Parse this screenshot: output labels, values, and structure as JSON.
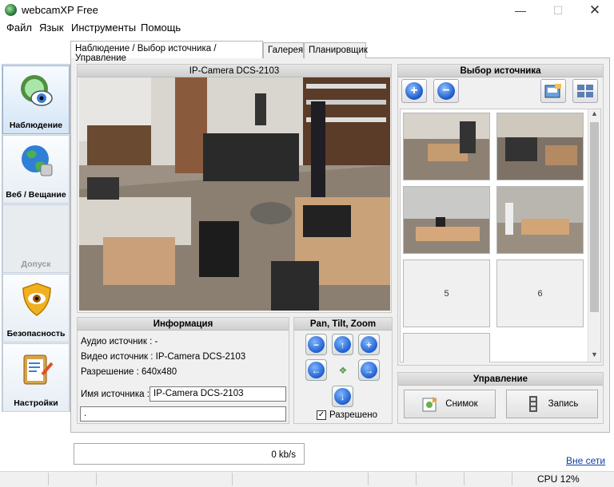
{
  "window": {
    "title": "webcamXP Free"
  },
  "menu": [
    "Файл",
    "Язык",
    "Инструменты",
    "Помощь"
  ],
  "sidebar": {
    "items": [
      {
        "label": "Наблюдение",
        "icon": "eye-camera-icon"
      },
      {
        "label": "Веб / Вещание",
        "icon": "globe-icon"
      },
      {
        "label": "Допуск",
        "icon": ""
      },
      {
        "label": "Безопасность",
        "icon": "shield-eye-icon"
      },
      {
        "label": "Настройки",
        "icon": "clipboard-settings-icon"
      }
    ]
  },
  "tabs": [
    "Наблюдение / Выбор источника / Управление",
    "Галерея",
    "Планировщик"
  ],
  "camera": {
    "title": "IP-Camera DCS-2103"
  },
  "info": {
    "header": "Информация",
    "audio": "Аудио источник : -",
    "video": "Видео источник : IP-Camera DCS-2103",
    "resolution": "Разрешение : 640x480",
    "source_name_label": "Имя источника :",
    "source_name_value": "IP-Camera DCS-2103",
    "extra_value": "."
  },
  "ptz": {
    "header": "Pan, Tilt, Zoom",
    "enabled_label": "Разрешено",
    "enabled": true
  },
  "source_select": {
    "header": "Выбор источника",
    "slots": [
      {
        "label": "",
        "filled": true
      },
      {
        "label": "",
        "filled": true
      },
      {
        "label": "",
        "filled": true
      },
      {
        "label": "",
        "filled": true
      },
      {
        "label": "5",
        "filled": false
      },
      {
        "label": "6",
        "filled": false
      },
      {
        "label": "",
        "filled": false
      }
    ]
  },
  "control": {
    "header": "Управление",
    "snapshot": "Снимок",
    "record": "Запись"
  },
  "status": {
    "rate": "0 kb/s",
    "network": "Вне сети",
    "cpu": "CPU 12%"
  }
}
